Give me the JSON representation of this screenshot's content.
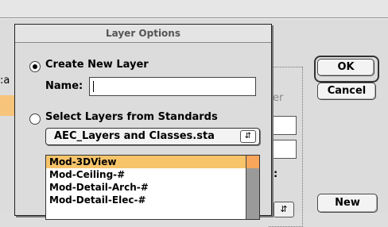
{
  "parent": {
    "left_text": ":a",
    "faint_text": "er",
    "colon": ":",
    "ok_label": "OK",
    "cancel_label": "Cancel",
    "new_label": "New",
    "stepper_icon": "updown-arrows-icon"
  },
  "dialog": {
    "title": "Layer Options",
    "create_label": "Create New Layer",
    "name_label": "Name:",
    "name_value": "",
    "select_label": "Select Layers from Standards",
    "standards_value": "AEC_Layers and Classes.sta",
    "layers": [
      "Mod-3DView",
      "Mod-Ceiling-#",
      "Mod-Detail-Arch-#",
      "Mod-Detail-Elec-#"
    ]
  },
  "colors": {
    "selection": "#f7c46a",
    "scroll_thumb": "#f7a65b"
  }
}
